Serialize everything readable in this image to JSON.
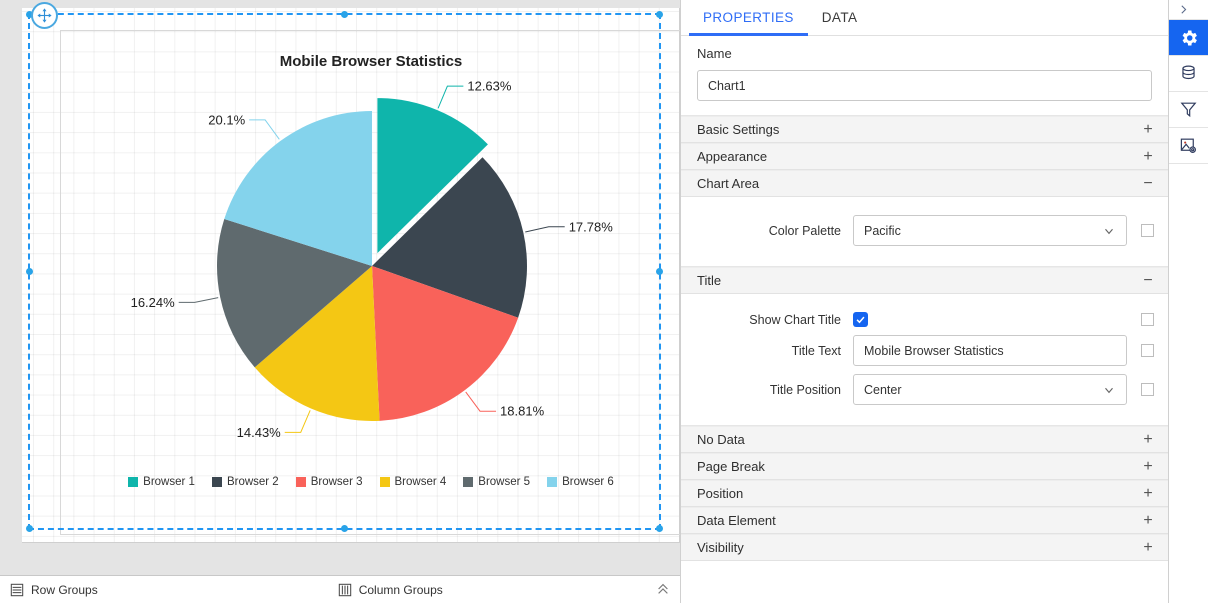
{
  "chart_data": {
    "type": "pie",
    "title": "Mobile Browser Statistics",
    "categories": [
      "Browser 1",
      "Browser 2",
      "Browser 3",
      "Browser 4",
      "Browser 5",
      "Browser 6"
    ],
    "values": [
      12.63,
      17.78,
      18.81,
      14.43,
      16.24,
      20.1
    ],
    "labels": [
      "12.63%",
      "17.78%",
      "18.81%",
      "14.43%",
      "16.24%",
      "20.1%"
    ],
    "colors": [
      "#0FB5AB",
      "#3B4650",
      "#F9625A",
      "#F4C714",
      "#5F6A6E",
      "#84D3EC"
    ],
    "exploded_index": 0,
    "legend_position": "bottom",
    "grid": true
  },
  "designer": {
    "move_handle_icon": "move-arrows-icon",
    "status_bar": {
      "row_groups_label": "Row Groups",
      "row_groups_icon": "row-groups-icon",
      "column_groups_label": "Column Groups",
      "column_groups_icon": "column-groups-icon",
      "collapse_icon": "chevron-double-up-icon"
    }
  },
  "panel": {
    "tabs": [
      {
        "label": "PROPERTIES",
        "active": true
      },
      {
        "label": "DATA",
        "active": false
      }
    ],
    "name": {
      "label": "Name",
      "value": "Chart1"
    },
    "sections": [
      {
        "title": "Basic Settings",
        "toggle": "+",
        "expanded": false
      },
      {
        "title": "Appearance",
        "toggle": "+",
        "expanded": false
      },
      {
        "title": "Chart Area",
        "toggle": "−",
        "expanded": true
      },
      {
        "title": "Title",
        "toggle": "−",
        "expanded": true
      },
      {
        "title": "No Data",
        "toggle": "+",
        "expanded": false
      },
      {
        "title": "Page Break",
        "toggle": "+",
        "expanded": false
      },
      {
        "title": "Position",
        "toggle": "+",
        "expanded": false
      },
      {
        "title": "Data Element",
        "toggle": "+",
        "expanded": false
      },
      {
        "title": "Visibility",
        "toggle": "+",
        "expanded": false
      }
    ],
    "chart_area": {
      "color_palette_label": "Color Palette",
      "color_palette_value": "Pacific"
    },
    "title_section": {
      "show_chart_title_label": "Show Chart Title",
      "show_chart_title_checked": true,
      "title_text_label": "Title Text",
      "title_text_value": "Mobile Browser Statistics",
      "title_position_label": "Title Position",
      "title_position_value": "Center"
    }
  },
  "rail": {
    "items": [
      {
        "icon": "chevron-right-icon",
        "active": false
      },
      {
        "icon": "gear-icon",
        "active": true
      },
      {
        "icon": "database-icon",
        "active": false
      },
      {
        "icon": "filter-funnel-icon",
        "active": false
      },
      {
        "icon": "image-settings-icon",
        "active": false
      }
    ]
  },
  "colors": {
    "accent": "#1565f0",
    "tab_accent": "#2f6df6",
    "selection": "#2196f3"
  }
}
